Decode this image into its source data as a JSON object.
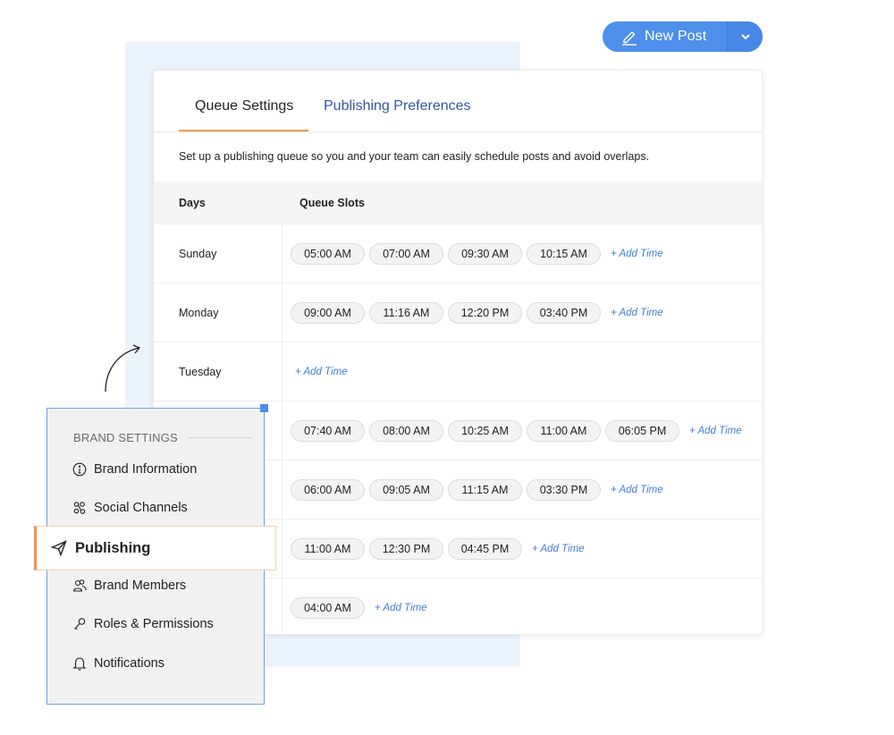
{
  "header": {
    "new_post_label": "New Post",
    "new_post_icon": "pencil-icon",
    "dropdown_icon": "chevron-down-icon",
    "accent_color": "#4d8fea"
  },
  "card": {
    "tabs": [
      {
        "label": "Queue Settings",
        "active": true
      },
      {
        "label": "Publishing Preferences",
        "active": false
      }
    ],
    "description": "Set up a publishing queue so you and your team can easily schedule posts and avoid overlaps.",
    "columns": [
      "Days",
      "Queue Slots"
    ],
    "add_time_label": "+ Add Time",
    "rows": [
      {
        "day": "Sunday",
        "slots": [
          "05:00 AM",
          "07:00 AM",
          "09:30 AM",
          "10:15 AM"
        ]
      },
      {
        "day": "Monday",
        "slots": [
          "09:00 AM",
          "11:16 AM",
          "12:20 PM",
          "03:40 PM"
        ]
      },
      {
        "day": "Tuesday",
        "slots": []
      },
      {
        "day": "",
        "slots": [
          "07:40 AM",
          "08:00 AM",
          "10:25 AM",
          "11:00 AM",
          "06:05 PM"
        ]
      },
      {
        "day": "",
        "slots": [
          "06:00 AM",
          "09:05 AM",
          "11:15 AM",
          "03:30 PM"
        ]
      },
      {
        "day": "",
        "slots": [
          "11:00 AM",
          "12:30 PM",
          "04:45 PM"
        ]
      },
      {
        "day": "",
        "slots": [
          "04:00 AM"
        ]
      }
    ]
  },
  "brand_settings": {
    "title": "BRAND SETTINGS",
    "items": [
      {
        "label": "Brand Information",
        "icon": "info-icon"
      },
      {
        "label": "Social Channels",
        "icon": "social-channels-icon"
      },
      {
        "label": "Publishing",
        "icon": "paper-plane-icon",
        "active": true
      },
      {
        "label": "Brand Members",
        "icon": "members-icon"
      },
      {
        "label": "Roles & Permissions",
        "icon": "key-icon"
      },
      {
        "label": "Notifications",
        "icon": "bell-icon"
      }
    ]
  }
}
